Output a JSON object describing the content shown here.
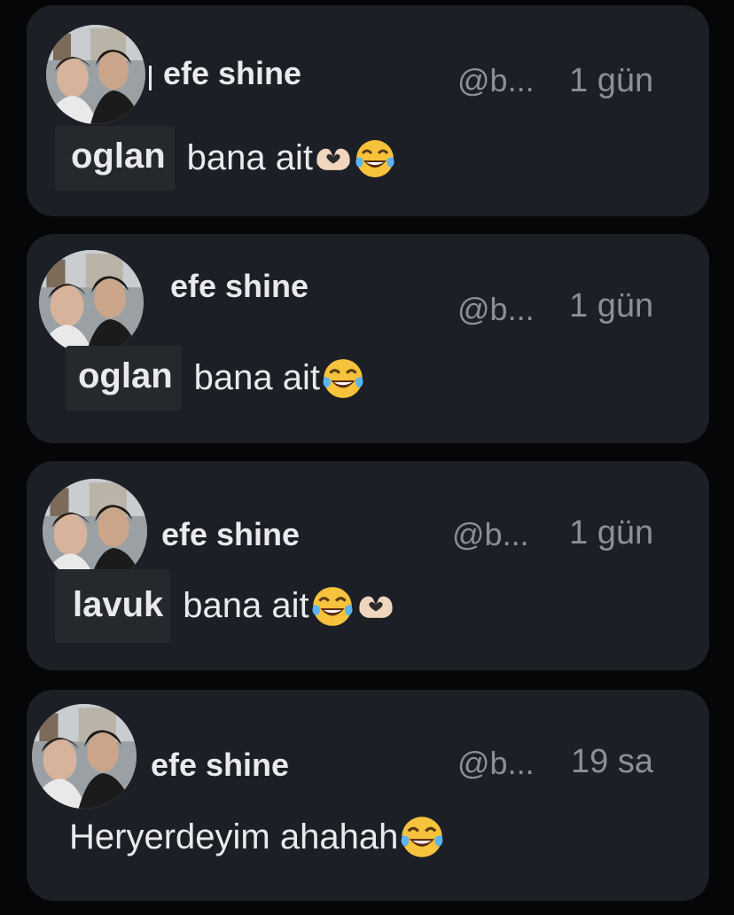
{
  "comments": [
    {
      "name": "efe shine",
      "handle": "@b...",
      "time": "1 gün",
      "highlight": "oglan",
      "text": "bana ait",
      "emojis": [
        "heart-hands",
        "laughing-tears"
      ]
    },
    {
      "name": "efe shine",
      "handle": "@b...",
      "time": "1 gün",
      "highlight": "oglan",
      "text": "bana ait",
      "emojis": [
        "laughing-tears"
      ]
    },
    {
      "name": "efe shine",
      "handle": "@b...",
      "time": "1 gün",
      "highlight": "lavuk",
      "text": "bana ait",
      "emojis": [
        "laughing-tears",
        "heart-hands"
      ]
    },
    {
      "name": "efe shine",
      "handle": "@b...",
      "time": "19 sa",
      "highlight": "",
      "text": "Heryerdeyim ahahah",
      "emojis": [
        "laughing-tears"
      ]
    }
  ],
  "colors": {
    "card": "#1c1f25",
    "background": "#050608",
    "text": "#e8eaed",
    "muted": "#8b9096"
  }
}
